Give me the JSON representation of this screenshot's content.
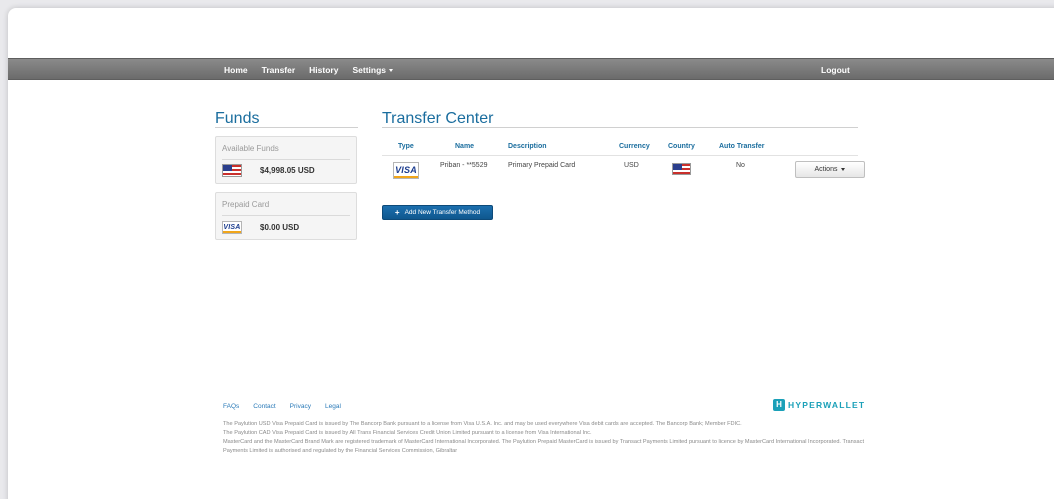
{
  "nav": {
    "home": "Home",
    "transfer": "Transfer",
    "history": "History",
    "settings": "Settings",
    "logout": "Logout"
  },
  "funds": {
    "title": "Funds",
    "available": {
      "label": "Available Funds",
      "amount": "$4,998.05 USD",
      "icon": "us-flag-icon"
    },
    "prepaid": {
      "label": "Prepaid Card",
      "amount": "$0.00 USD",
      "icon": "visa-card-icon"
    }
  },
  "transfer_center": {
    "title": "Transfer Center",
    "columns": [
      "Type",
      "Name",
      "Description",
      "Currency",
      "Country",
      "Auto Transfer"
    ],
    "rows": [
      {
        "type": "VISA",
        "name": "Priban - **5529",
        "description": "Primary Prepaid Card",
        "currency": "USD",
        "country": "us-flag-icon",
        "auto_transfer": "No",
        "actions_label": "Actions"
      }
    ],
    "add_button": "Add New Transfer Method"
  },
  "footer": {
    "links": [
      "FAQs",
      "Contact",
      "Privacy",
      "Legal"
    ],
    "logo_mark": "H",
    "logo_text": "HYPERWALLET",
    "legal": [
      "The Paylution USD Visa Prepaid Card is issued by The Bancorp Bank pursuant to a license from Visa U.S.A. Inc. and may be used everywhere Visa debit cards are accepted. The Bancorp Bank; Member FDIC.",
      "The Paylution CAD Visa Prepaid Card is issued by All Trans Financial Services Credit Union Limited pursuant to a license from Visa International Inc.",
      "MasterCard and the MasterCard Brand Mark are registered trademark of MasterCard International Incorporated. The Paylution Prepaid MasterCard is issued by Transact Payments Limited pursuant to licence by MasterCard International Incorporated. Transact Payments Limited is authorised and regulated by the Financial Services Commission, Gibraltar"
    ]
  },
  "colors": {
    "accent": "#1a6d9e",
    "button_primary": "#1c6fae",
    "navbar": "#7a7a7a",
    "brand": "#1aa0b8"
  }
}
